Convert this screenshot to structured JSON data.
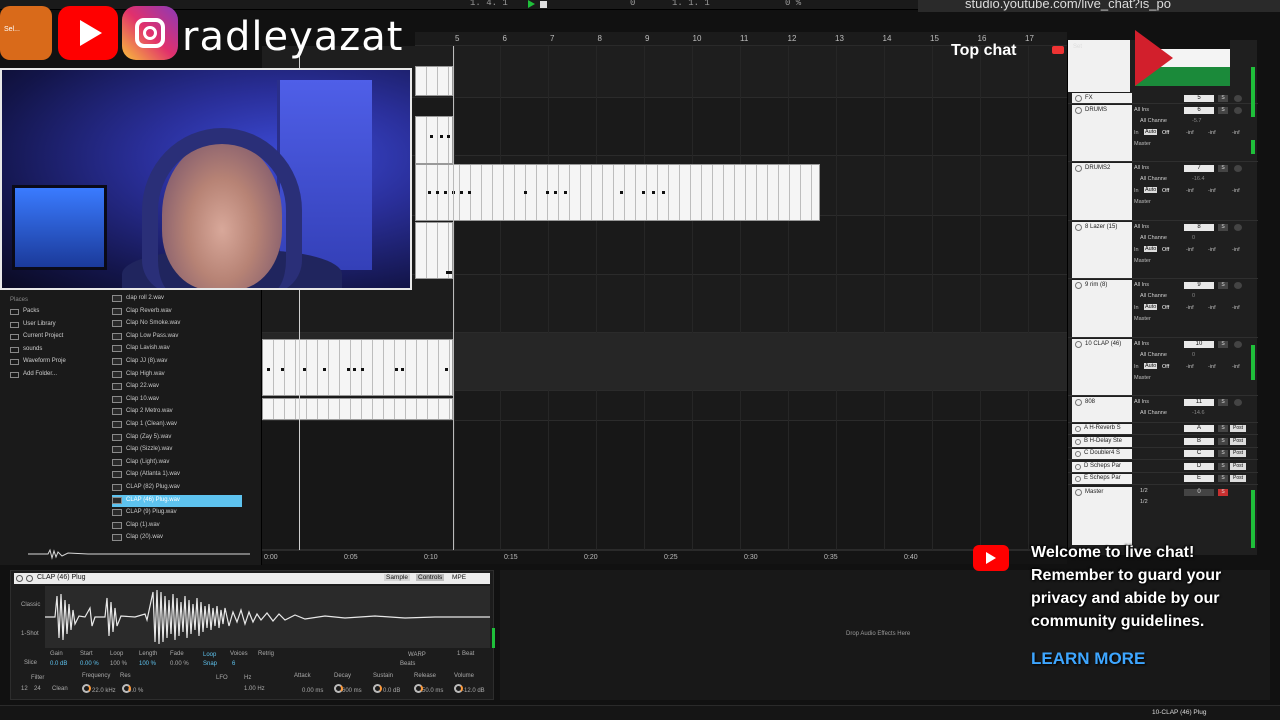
{
  "overlay": {
    "brand_badge_text": "Sel...",
    "handle": "radleyazat",
    "top_chat": "Top chat",
    "set_label": "Set",
    "url": "studio.youtube.com/live_chat?is_po",
    "welcome_line": "Welcome to live chat! Remember to guard your privacy and abide by our community guidelines.",
    "learn_more": "LEARN MORE"
  },
  "transport": {
    "position": "1. 4. 1",
    "loop_start": "0",
    "loop_end": "1. 1. 1",
    "cpu": "0 %"
  },
  "ruler": {
    "bars": [
      "5",
      "6",
      "7",
      "8",
      "9",
      "10",
      "11",
      "12",
      "13",
      "14",
      "15",
      "16",
      "17"
    ]
  },
  "timeline": {
    "labels": [
      "0:00",
      "0:05",
      "0:10",
      "0:15",
      "0:20",
      "0:25",
      "0:30",
      "0:35",
      "0:40"
    ]
  },
  "mixer": {
    "tracks": [
      {
        "name": "FX",
        "num": "5",
        "input": "",
        "vol": ""
      },
      {
        "name": "DRUMS",
        "num": "6",
        "input": "All Ins",
        "channel": "All Channe",
        "vol": "-5.7",
        "mode_in": "In",
        "mode_auto": "Auto",
        "mode_off": "Off",
        "out": "Master",
        "inf": "-inf"
      },
      {
        "name": "DRUMS2",
        "num": "7",
        "input": "All Ins",
        "channel": "All Channe",
        "vol": "-16.4",
        "mode_in": "In",
        "mode_auto": "Auto",
        "mode_off": "Off",
        "out": "Master",
        "inf": "-inf"
      },
      {
        "name": "8 Lazer (15)",
        "num": "8",
        "input": "All Ins",
        "channel": "All Channe",
        "vol": "0",
        "mode_in": "In",
        "mode_auto": "Auto",
        "mode_off": "Off",
        "out": "Master",
        "inf": "-inf"
      },
      {
        "name": "9 rim (8)",
        "num": "9",
        "input": "All Ins",
        "channel": "All Channe",
        "vol": "0",
        "mode_in": "In",
        "mode_auto": "Auto",
        "mode_off": "Off",
        "out": "Master",
        "inf": "-inf"
      },
      {
        "name": "10 CLAP (46)",
        "num": "10",
        "input": "All Ins",
        "channel": "All Channe",
        "vol": "0",
        "mode_in": "In",
        "mode_auto": "Auto",
        "mode_off": "Off",
        "out": "Master",
        "inf": "-inf"
      },
      {
        "name": "808",
        "num": "11",
        "input": "All Ins",
        "channel": "All Channe",
        "vol": "-14.6",
        "out": ""
      }
    ],
    "returns": [
      {
        "name": "A H-Reverb S",
        "letter": "A",
        "post": "Post"
      },
      {
        "name": "B H-Delay Ste",
        "letter": "B",
        "post": "Post"
      },
      {
        "name": "C Doubler4 S",
        "letter": "C",
        "post": "Post"
      },
      {
        "name": "D Scheps Par",
        "letter": "D",
        "post": "Post"
      },
      {
        "name": "E Scheps Par",
        "letter": "E",
        "post": "Post"
      }
    ],
    "master": {
      "name": "Master",
      "in1": "1/2",
      "in2": "1/2",
      "vol": "0",
      "solo": "S"
    }
  },
  "browser": {
    "places_title": "Places",
    "places": [
      "Packs",
      "User Library",
      "Current Project",
      "sounds",
      "Waveform Proje",
      "Add Folder..."
    ],
    "files": [
      "clap roll 2.wav",
      "Clap Reverb.wav",
      "Clap No Smoke.wav",
      "Clap Low Pass.wav",
      "Clap Lavish.wav",
      "Clap JJ (8).wav",
      "Clap High.wav",
      "Clap 22.wav",
      "Clap 10.wav",
      "Clap 2 Metro.wav",
      "Clap 1 (Clean).wav",
      "Clap (Zay 5).wav",
      "Clap (Sizzle).wav",
      "Clap (Light).wav",
      "Clap (Atlanta 1).wav",
      "CLAP (82) Plug.wav",
      "CLAP (46) Plug.wav",
      "CLAP (9) Plug.wav",
      "Clap (1).wav",
      "Clap (20).wav"
    ],
    "selected_index": 16
  },
  "detail": {
    "clip_name": "CLAP (46) Plug",
    "tab_sample": "Sample",
    "tab_controls": "Controls",
    "tab_mpe": "MPE",
    "mode": "Classic",
    "one_shot": "1-Shot",
    "slice": "Slice",
    "gain_lbl": "Gain",
    "gain_val": "0.0 dB",
    "start_lbl": "Start",
    "start_val": "0.00 %",
    "loop_lbl": "Loop",
    "loop_val": "100 %",
    "length_lbl": "Length",
    "length_val": "100 %",
    "fade_lbl": "Fade",
    "fade_val": "0.00 %",
    "loop_btn": "Loop",
    "snap_btn": "Snap",
    "voices_lbl": "Voices",
    "voices_val": "6",
    "retrig_lbl": "Retrig",
    "warp_btn": "WARP",
    "beats_lbl": "Beats",
    "beat_val": "1 Beat",
    "filter_lbl": "Filter",
    "filter_num": "12",
    "filter_num2": "24",
    "filter_type": "Clean",
    "freq_lbl": "Frequency",
    "freq_val": "22.0 kHz",
    "res_lbl": "Res",
    "res_val": "0.0 %",
    "lfo_lbl": "LFO",
    "lfo_hz": "Hz",
    "lfo_rate": "1.00 Hz",
    "attack_lbl": "Attack",
    "attack_val": "0.00 ms",
    "decay_lbl": "Decay",
    "decay_val": "600 ms",
    "sustain_lbl": "Sustain",
    "sustain_val": "0.0 dB",
    "release_lbl": "Release",
    "release_val": "50.0 ms",
    "volume_lbl": "Volume",
    "volume_val": "-12.0 dB",
    "drop_text": "Drop Audio Effects Here"
  },
  "status": {
    "right_label": "10-CLAP (46) Plug"
  },
  "colors": {
    "accent": "#5ec3ef",
    "meter": "#1fbf3a",
    "youtube_red": "#ff0000",
    "learn_more": "#3ea6ff"
  }
}
